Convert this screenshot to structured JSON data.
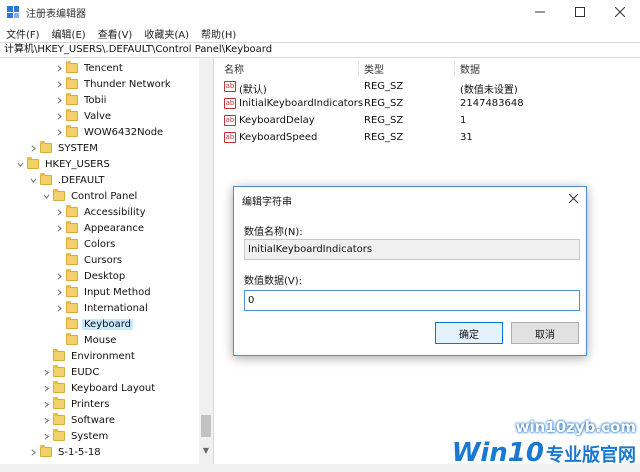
{
  "window": {
    "title": "注册表编辑器",
    "minimize_glyph": "—",
    "maximize_glyph": "☐",
    "close_glyph": "✕"
  },
  "menu": [
    "文件(F)",
    "编辑(E)",
    "查看(V)",
    "收藏夹(A)",
    "帮助(H)"
  ],
  "address": "计算机\\HKEY_USERS\\.DEFAULT\\Control Panel\\Keyboard",
  "tree": [
    {
      "label": "Tencent",
      "chevron": "right",
      "selected": false
    },
    {
      "label": "Thunder Network",
      "chevron": "right",
      "selected": false
    },
    {
      "label": "Tobii",
      "chevron": "right",
      "selected": false
    },
    {
      "label": "Valve",
      "chevron": "right",
      "selected": false
    },
    {
      "label": "WOW6432Node",
      "chevron": "right",
      "selected": false
    },
    {
      "label": "SYSTEM",
      "chevron": "right",
      "selected": false
    },
    {
      "label": "HKEY_USERS",
      "chevron": "down",
      "selected": false
    },
    {
      "label": ".DEFAULT",
      "chevron": "down",
      "selected": false
    },
    {
      "label": "Control Panel",
      "chevron": "down",
      "selected": false
    },
    {
      "label": "Accessibility",
      "chevron": "right",
      "selected": false
    },
    {
      "label": "Appearance",
      "chevron": "right",
      "selected": false
    },
    {
      "label": "Colors",
      "chevron": "none",
      "selected": false
    },
    {
      "label": "Cursors",
      "chevron": "none",
      "selected": false
    },
    {
      "label": "Desktop",
      "chevron": "right",
      "selected": false
    },
    {
      "label": "Input Method",
      "chevron": "right",
      "selected": false
    },
    {
      "label": "International",
      "chevron": "right",
      "selected": false
    },
    {
      "label": "Keyboard",
      "chevron": "none",
      "selected": true
    },
    {
      "label": "Mouse",
      "chevron": "none",
      "selected": false
    },
    {
      "label": "Environment",
      "chevron": "none",
      "selected": false
    },
    {
      "label": "EUDC",
      "chevron": "right",
      "selected": false
    },
    {
      "label": "Keyboard Layout",
      "chevron": "right",
      "selected": false
    },
    {
      "label": "Printers",
      "chevron": "right",
      "selected": false
    },
    {
      "label": "Software",
      "chevron": "right",
      "selected": false
    },
    {
      "label": "System",
      "chevron": "right",
      "selected": false
    },
    {
      "label": "S-1-5-18",
      "chevron": "right",
      "selected": false
    }
  ],
  "columns": {
    "name": "名称",
    "type": "类型",
    "data": "数据"
  },
  "values": [
    {
      "icon": "ab",
      "name": "(默认)",
      "type": "REG_SZ",
      "data": "(数值未设置)"
    },
    {
      "icon": "ab",
      "name": "InitialKeyboardIndicators",
      "type": "REG_SZ",
      "data": "2147483648"
    },
    {
      "icon": "ab",
      "name": "KeyboardDelay",
      "type": "REG_SZ",
      "data": "1"
    },
    {
      "icon": "ab",
      "name": "KeyboardSpeed",
      "type": "REG_SZ",
      "data": "31"
    }
  ],
  "dialog": {
    "title": "编辑字符串",
    "name_label": "数值名称(N):",
    "name_value": "InitialKeyboardIndicators",
    "data_label": "数值数据(V):",
    "data_value": "0",
    "ok_label": "确定",
    "cancel_label": "取消"
  },
  "watermark": {
    "url": "win10zyb.com",
    "brand_a": "Win10",
    "brand_b": "专业版官网"
  },
  "colors": {
    "accent": "#0078d7",
    "selection": "#cce8ff",
    "folder": "#f4d06a",
    "watermark_blue": "#1a78d0"
  }
}
